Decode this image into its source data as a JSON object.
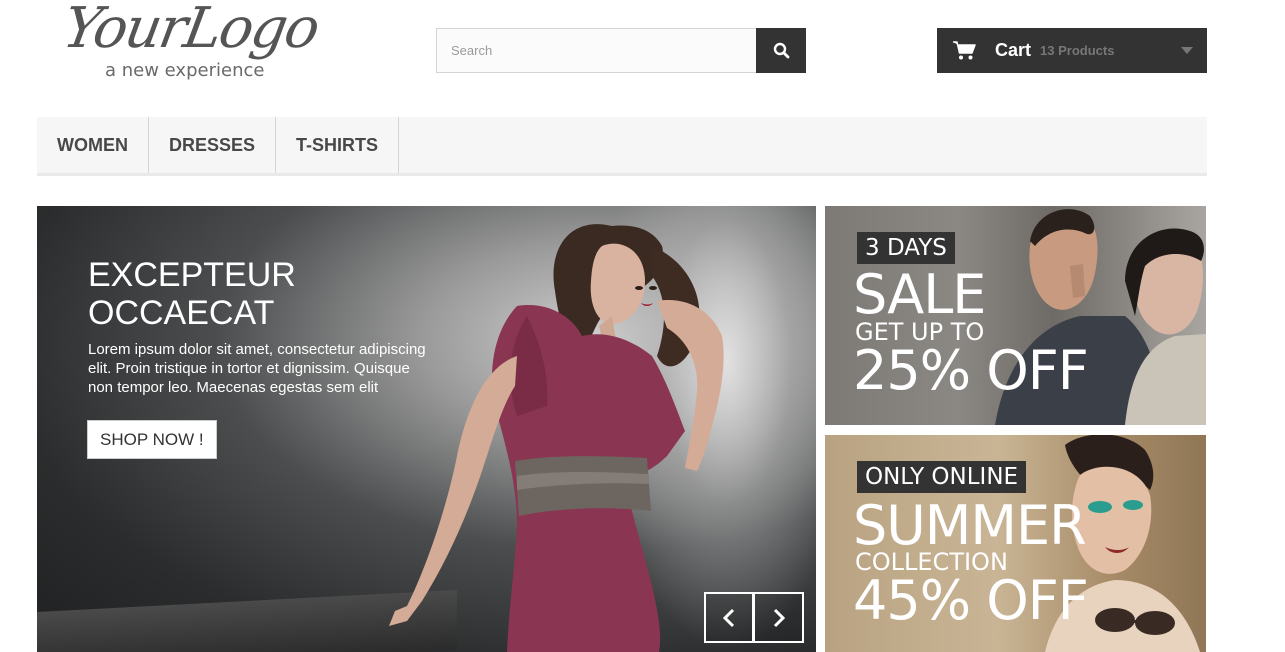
{
  "header": {
    "logo": {
      "script_text": "YourLogo",
      "tagline": "a new experience"
    },
    "search": {
      "placeholder": "Search",
      "icon": "search-icon"
    },
    "cart": {
      "icon": "cart-icon",
      "label": "Cart",
      "count": "13 Products",
      "dropdown_icon": "caret-down-icon"
    }
  },
  "menu": {
    "items": [
      {
        "label": "WOMEN"
      },
      {
        "label": "DRESSES"
      },
      {
        "label": "T-SHIRTS"
      }
    ]
  },
  "slider": {
    "title_line1": "EXCEPTEUR",
    "title_line2": "OCCAECAT",
    "text": "Lorem ipsum dolor sit amet, consectetur adipiscing elit. Proin tristique in tortor et dignissim. Quisque non tempor leo. Maecenas egestas sem elit",
    "button": "SHOP NOW !",
    "prev_icon": "chevron-left-icon",
    "next_icon": "chevron-right-icon"
  },
  "banners": [
    {
      "tag": "3 DAYS",
      "big": "SALE",
      "sub": "GET UP TO",
      "offer": "25% OFF"
    },
    {
      "tag": "ONLY ONLINE",
      "big": "SUMMER",
      "sub": "COLLECTION",
      "offer": "45% OFF"
    }
  ]
}
